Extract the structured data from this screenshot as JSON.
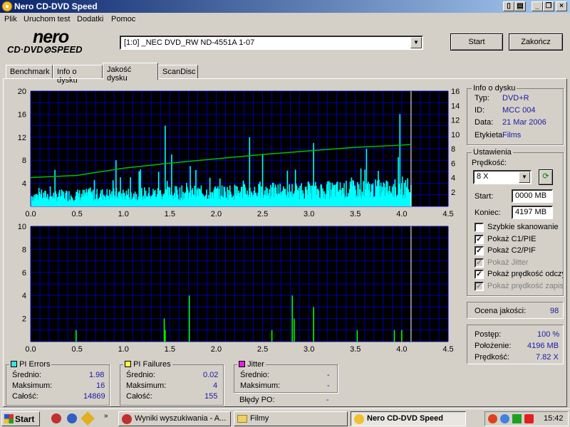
{
  "window": {
    "title": "Nero CD-DVD Speed"
  },
  "menu": [
    "Plik",
    "Uruchom test",
    "Dodatki",
    "Pomoc"
  ],
  "logo": {
    "top": "nero",
    "bottom": "CD·DVD⊘SPEED"
  },
  "drive": {
    "value": "[1:0]  _NEC DVD_RW ND-4551A 1-07"
  },
  "buttons": {
    "start": "Start",
    "exit": "Zakończ"
  },
  "tabs": [
    "Benchmark",
    "Info o dysku",
    "Jakość dysku",
    "ScanDisc"
  ],
  "disc_info": {
    "title": "Info o dysku",
    "type_label": "Typ:",
    "type_value": "DVD+R",
    "id_label": "ID:",
    "id_value": "MCC 004",
    "date_label": "Data:",
    "date_value": "21 Mar 2006",
    "tag_label": "Etykieta",
    "tag_value": "Films"
  },
  "settings": {
    "title": "Ustawienia",
    "speed_label": "Prędkość:",
    "speed_value": "8 X",
    "start_label": "Start:",
    "start_value": "0000 MB",
    "end_label": "Koniec:",
    "end_value": "4197 MB",
    "checkboxes": [
      {
        "label": "Szybkie skanowanie",
        "checked": false,
        "disabled": false
      },
      {
        "label": "Pokaż C1/PIE",
        "checked": true,
        "disabled": false
      },
      {
        "label": "Pokaż C2/PIF",
        "checked": true,
        "disabled": false
      },
      {
        "label": "Pokaż Jitter",
        "checked": true,
        "disabled": true
      },
      {
        "label": "Pokaż prędkość odczytu",
        "checked": true,
        "disabled": false
      },
      {
        "label": "Pokaż prędkość zapisu",
        "checked": true,
        "disabled": true
      }
    ]
  },
  "quality": {
    "label": "Ocena jakości:",
    "value": "98"
  },
  "progress": {
    "progress_label": "Postęp:",
    "progress_value": "100 %",
    "position_label": "Położenie:",
    "position_value": "4196 MB",
    "speed_label": "Prędkość:",
    "speed_value": "7.82 X"
  },
  "pi_errors": {
    "title": "PI Errors",
    "avg_label": "Średnio:",
    "avg": "1.98",
    "max_label": "Maksimum:",
    "max": "16",
    "total_label": "Całość:",
    "total": "14869",
    "color": "#40e0e0"
  },
  "pi_failures": {
    "title": "PI Failures",
    "avg_label": "Średnio:",
    "avg": "0.02",
    "max_label": "Maksimum:",
    "max": "4",
    "total_label": "Całość:",
    "total": "155",
    "color": "#ffff40"
  },
  "jitter": {
    "title": "Jitter",
    "avg_label": "Średnio:",
    "avg": "-",
    "max_label": "Maksimum:",
    "max": "-",
    "color": "#e020e0"
  },
  "po_errors": {
    "label": "Błędy PO:",
    "value": "-"
  },
  "taskbar": {
    "start": "Start",
    "tasks": [
      "Wyniki wyszukiwania - A...",
      "Filmy",
      "Nero CD-DVD Speed"
    ],
    "clock": "15:42"
  },
  "colors": {
    "pie": "#00ffff",
    "pif": "#00ff00",
    "speed": "#00c000",
    "grid": "#0000c0",
    "chart_bg": "#000000"
  },
  "chart_data": [
    {
      "type": "bar",
      "xlim": [
        0,
        4.5
      ],
      "ylim": [
        0,
        20
      ],
      "y2lim": [
        0,
        16
      ],
      "x_ticks": [
        "0.0",
        "0.5",
        "1.0",
        "1.5",
        "2.0",
        "2.5",
        "3.0",
        "3.5",
        "4.0",
        "4.5"
      ],
      "y_ticks": [
        "4",
        "8",
        "12",
        "16",
        "20"
      ],
      "y2_ticks": [
        "2",
        "4",
        "6",
        "8",
        "10",
        "12",
        "14",
        "16"
      ],
      "series": [
        {
          "name": "PI Errors",
          "baseline_x": [
            0,
            4.1
          ],
          "baseline_y": [
            2,
            3.5
          ],
          "max": 16
        },
        {
          "name": "speed",
          "x": [
            0,
            0.5,
            1.0,
            1.5,
            2.0,
            2.5,
            3.0,
            3.5,
            4.0,
            4.1
          ],
          "y": [
            4.0,
            4.3,
            5.3,
            6.0,
            6.6,
            7.2,
            7.7,
            8.2,
            8.5,
            8.6
          ]
        }
      ],
      "spikes": [
        {
          "x": 1.45,
          "y": 14
        },
        {
          "x": 1.38,
          "y": 6
        },
        {
          "x": 1.52,
          "y": 9
        },
        {
          "x": 0.92,
          "y": 8
        },
        {
          "x": 2.36,
          "y": 12
        },
        {
          "x": 2.5,
          "y": 9
        },
        {
          "x": 3.05,
          "y": 11
        },
        {
          "x": 3.62,
          "y": 10
        },
        {
          "x": 3.98,
          "y": 16
        },
        {
          "x": 1.17,
          "y": 6
        },
        {
          "x": 1.72,
          "y": 7
        }
      ]
    },
    {
      "type": "bar",
      "xlim": [
        0,
        4.5
      ],
      "ylim": [
        0,
        10
      ],
      "x_ticks": [
        "0.0",
        "0.5",
        "1.0",
        "1.5",
        "2.0",
        "2.5",
        "3.0",
        "3.5",
        "4.0",
        "4.5"
      ],
      "y_ticks": [
        "2",
        "4",
        "6",
        "8",
        "10"
      ],
      "series": [
        {
          "name": "PI Failures",
          "x": [
            0.49,
            1.44,
            1.45,
            1.71,
            2.6,
            2.82,
            2.84,
            3.05,
            3.52,
            3.92,
            4.0
          ],
          "y": [
            1,
            2,
            1,
            4,
            1,
            4,
            2,
            3,
            1,
            1,
            1
          ]
        }
      ]
    }
  ]
}
